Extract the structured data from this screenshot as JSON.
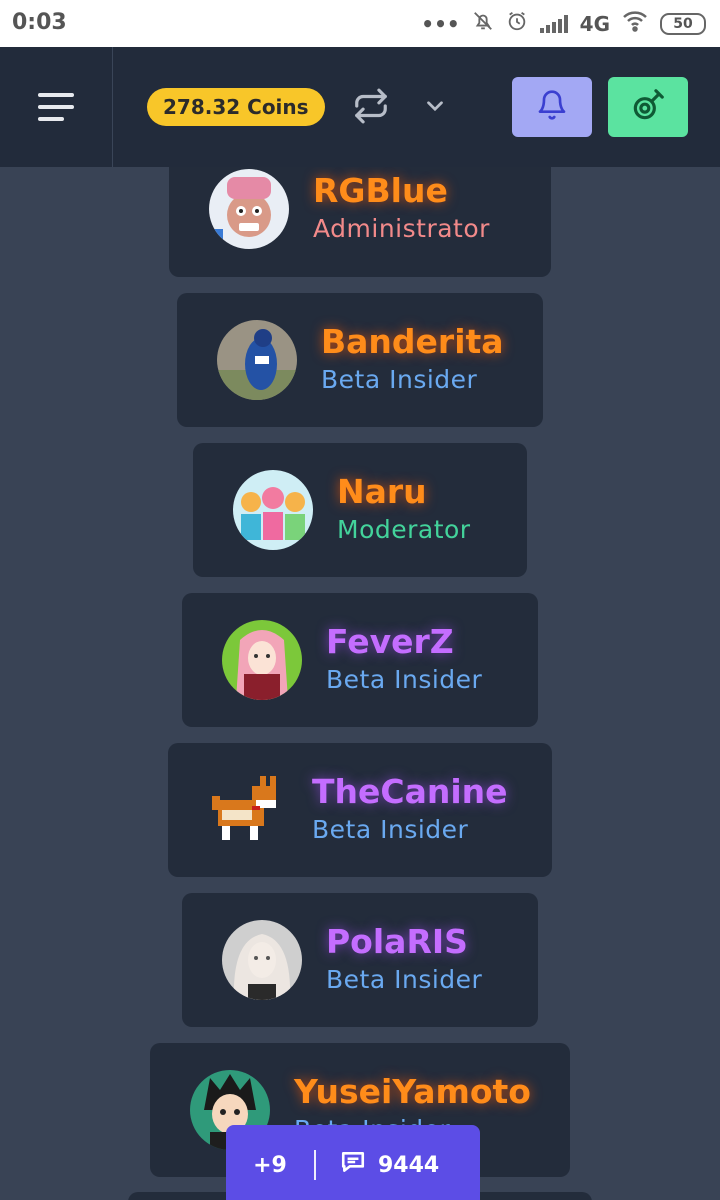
{
  "status_bar": {
    "time": "0:03",
    "network": "4G",
    "battery": "50"
  },
  "header": {
    "coins": "278.32 Coins",
    "icons": [
      "menu-icon",
      "swap-icon",
      "chevron-down-icon",
      "bell-icon",
      "coin-icon"
    ],
    "colors": {
      "bell_button": "#a3a8f4",
      "coin_button": "#5be3a0",
      "coins_badge": "#f8c629"
    }
  },
  "users": [
    {
      "name": "RGBlue",
      "role": "Administrator"
    },
    {
      "name": "Banderita",
      "role": "Beta Insider"
    },
    {
      "name": "Naru",
      "role": "Moderator"
    },
    {
      "name": "FeverZ",
      "role": "Beta Insider"
    },
    {
      "name": "TheCanine",
      "role": "Beta Insider"
    },
    {
      "name": "PolaRIS",
      "role": "Beta Insider"
    },
    {
      "name": "YuseiYamoto",
      "role": "Beta Insider"
    }
  ],
  "chat": {
    "extra": "+9",
    "message_count": "9444"
  }
}
